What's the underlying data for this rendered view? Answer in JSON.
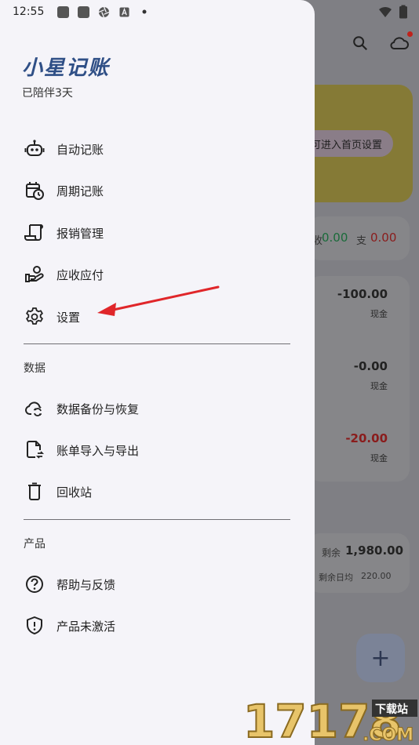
{
  "status_bar": {
    "time": "12:55"
  },
  "drawer": {
    "app_title": "小星记账",
    "app_subtitle": "已陪伴3天",
    "items": [
      {
        "label": "自动记账",
        "icon": "robot-icon"
      },
      {
        "label": "周期记账",
        "icon": "calendar-clock-icon"
      },
      {
        "label": "报销管理",
        "icon": "receipt-icon"
      },
      {
        "label": "应收应付",
        "icon": "hand-coin-icon"
      },
      {
        "label": "设置",
        "icon": "gear-icon"
      }
    ],
    "section_data": {
      "title": "数据",
      "items": [
        {
          "label": "数据备份与恢复",
          "icon": "cloud-sync-icon"
        },
        {
          "label": "账单导入与导出",
          "icon": "file-transfer-icon"
        },
        {
          "label": "回收站",
          "icon": "trash-icon"
        }
      ]
    },
    "section_product": {
      "title": "产品",
      "items": [
        {
          "label": "帮助与反馈",
          "icon": "help-circle-icon"
        },
        {
          "label": "产品未激活",
          "icon": "shield-alert-icon"
        }
      ]
    }
  },
  "background": {
    "banner_pill": "可进入首页设置",
    "summary": {
      "income_label": "收",
      "income_value": "0.00",
      "expense_label": "支",
      "expense_value": "0.00"
    },
    "transactions": [
      {
        "amount": "-100.00",
        "account": "现金"
      },
      {
        "amount": "-0.00",
        "account": "现金"
      },
      {
        "amount": "-20.00",
        "account": "现金"
      }
    ],
    "budget": {
      "remaining_label": "剩余",
      "remaining_value": "1,980.00",
      "daily_label": "剩余日均",
      "daily_value": "220.00"
    },
    "fab": "+"
  },
  "watermark": {
    "text": "17178",
    "site": "下载站",
    "domain": ".COM"
  },
  "colors": {
    "accent": "#2f4f86",
    "income": "#1a6b3a",
    "expense": "#8a1c1c",
    "arrow": "#e0262a"
  }
}
